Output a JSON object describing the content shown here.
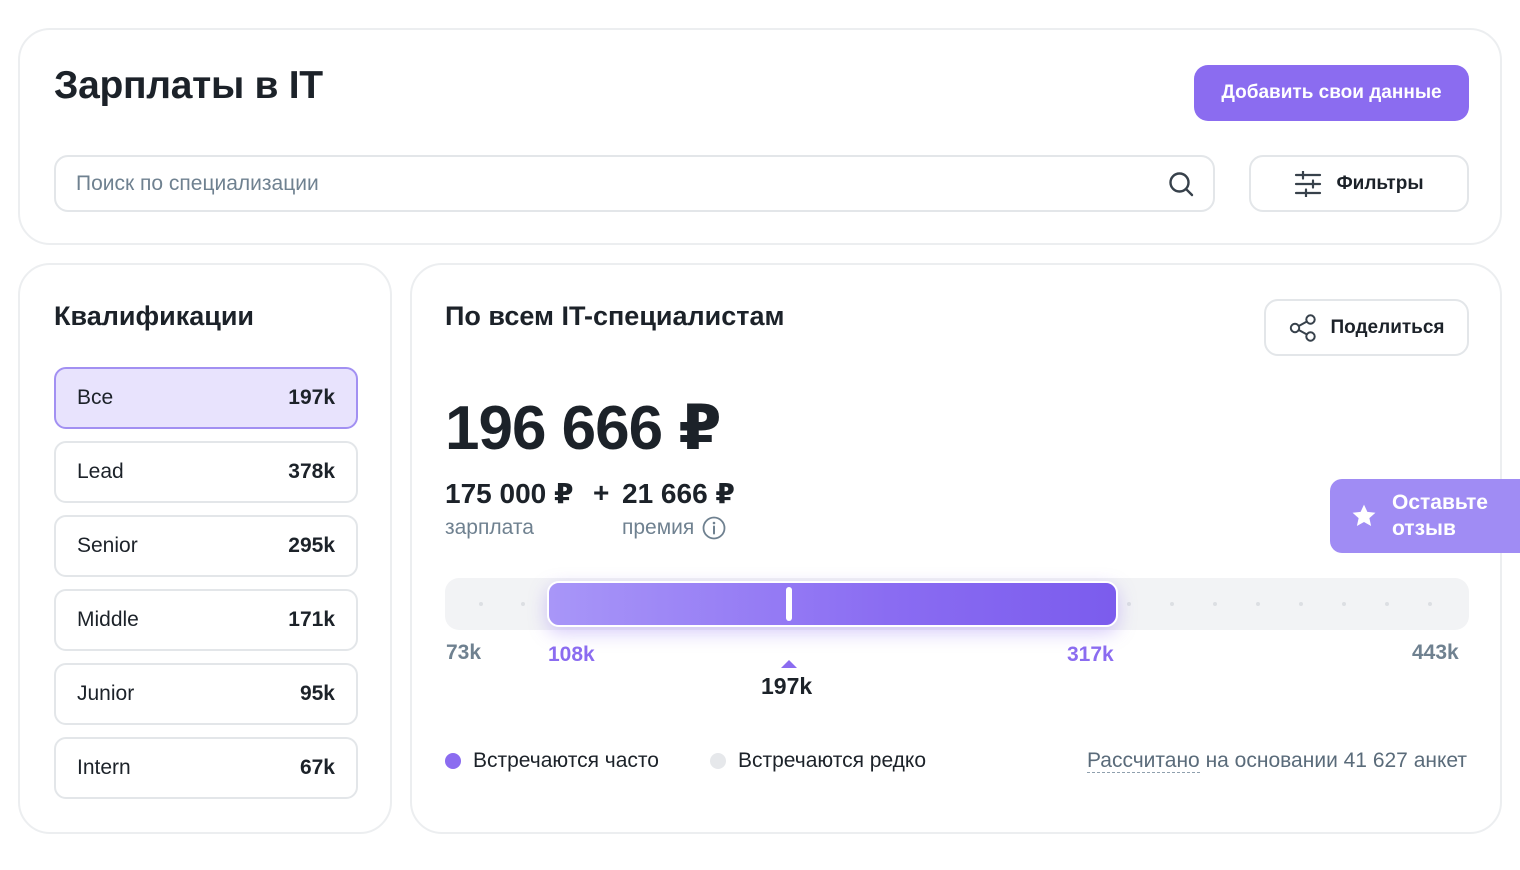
{
  "header": {
    "title": "Зарплаты в IT",
    "add_data_label": "Добавить свои данные",
    "search_placeholder": "Поиск по специализации",
    "filters_label": "Фильтры"
  },
  "qualifications": {
    "title": "Квалификации",
    "items": [
      {
        "label": "Все",
        "value": "197k",
        "active": true
      },
      {
        "label": "Lead",
        "value": "378k"
      },
      {
        "label": "Senior",
        "value": "295k"
      },
      {
        "label": "Middle",
        "value": "171k"
      },
      {
        "label": "Junior",
        "value": "95k"
      },
      {
        "label": "Intern",
        "value": "67k"
      }
    ]
  },
  "main": {
    "title": "По всем IT-специалистам",
    "share_label": "Поделиться",
    "total": "196 666 ₽",
    "salary_amount": "175 000 ₽",
    "plus": "+",
    "bonus_amount": "21 666 ₽",
    "salary_label": "зарплата",
    "bonus_label": "премия",
    "range": {
      "min": "73k",
      "p25": "108k",
      "median": "197k",
      "p75": "317k",
      "max": "443k"
    },
    "legend": {
      "often": "Встречаются часто",
      "rare": "Встречаются редко",
      "often_color": "#8b6cf0",
      "rare_color": "#e6e8eb"
    },
    "based_on_link": "Рассчитано",
    "based_on_rest": " на основании 41 627 анкет"
  },
  "feedback": {
    "label": "Оставьте отзыв",
    "icon": "star-icon"
  },
  "colors": {
    "accent": "#8b6cf0",
    "active_bg": "#e8e3fd",
    "muted_text": "#6f8190"
  }
}
